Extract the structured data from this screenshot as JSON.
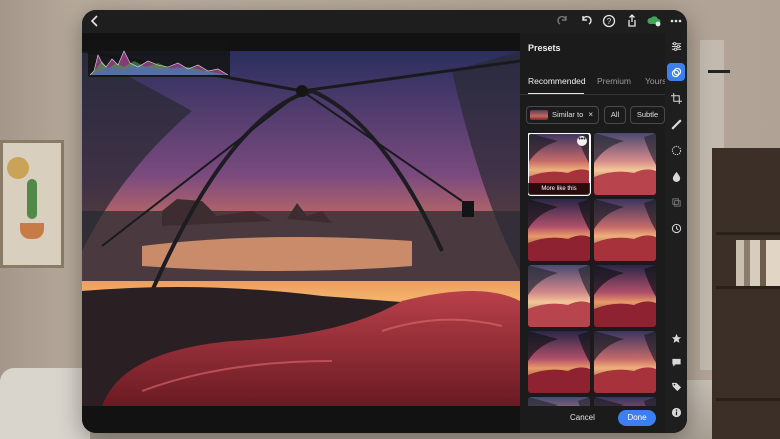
{
  "presets_panel": {
    "title": "Presets",
    "tabs": [
      "Recommended",
      "Premium",
      "Yours"
    ],
    "active_tab": "Recommended",
    "filters": {
      "similar_to_label": "Similar to",
      "similar_to_clear": "×",
      "all_label": "All",
      "subtle_label": "Subtle"
    },
    "selected_preset_action": "More like this",
    "selected_preset_menu": "•••",
    "footer": {
      "cancel_label": "Cancel",
      "done_label": "Done"
    }
  },
  "topbar": {
    "icons": [
      "back-chevron-icon",
      "redo-icon",
      "undo-icon",
      "help-icon",
      "share-icon",
      "cloud-sync-icon",
      "more-icon"
    ]
  },
  "right_rail": {
    "icons": [
      "sliders-icon",
      "presets-icon",
      "crop-icon",
      "healing-brush-icon",
      "masking-icon",
      "blur-icon",
      "versions-icon",
      "history-icon",
      "star-icon",
      "comment-icon",
      "tag-icon",
      "info-icon"
    ],
    "active": "presets-icon"
  },
  "colors": {
    "accent": "#3b7ff0",
    "panel_bg": "#1b1b1b",
    "window_bg": "#1e1e1e"
  }
}
